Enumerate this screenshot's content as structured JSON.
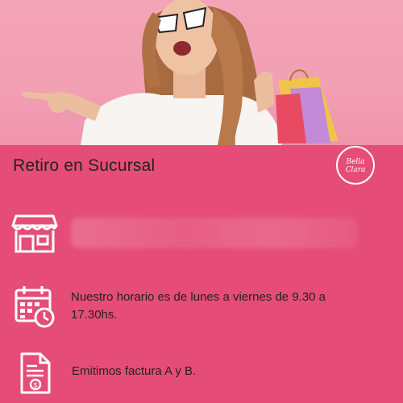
{
  "hero": {
    "image": "woman-with-shopping-bags-pointing"
  },
  "panel": {
    "title": "Retiro en Sucursal",
    "logo": "Bella Clara",
    "colors": {
      "panel_bg": "#e54d78",
      "hero_bg": "#f2a0b4",
      "text": "#222222",
      "icon_white": "#ffffff"
    },
    "rows": [
      {
        "icon": "storefront-icon",
        "text": ""
      },
      {
        "icon": "calendar-clock-icon",
        "line1": "Nuestro horario es de lunes a viernes de 9.30 a",
        "line2": "17.30hs."
      },
      {
        "icon": "invoice-dollar-icon",
        "text": "Emitimos factura A y B."
      }
    ]
  }
}
